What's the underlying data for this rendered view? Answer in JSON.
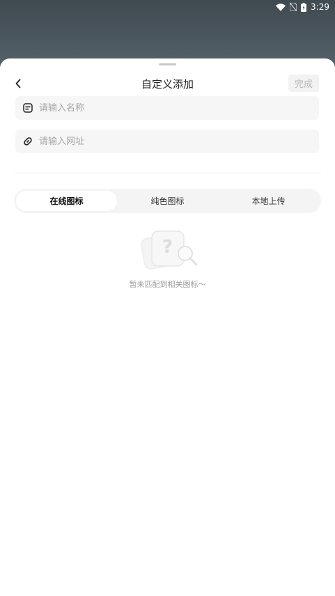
{
  "status_bar": {
    "time": "3:29",
    "icons": [
      "wifi-icon",
      "no-sim-icon",
      "battery-charging-icon"
    ]
  },
  "header": {
    "title": "自定义添加",
    "back_icon": "chevron-left-icon",
    "done_label": "完成"
  },
  "form": {
    "name_placeholder": "请输入名称",
    "name_icon": "label-icon",
    "url_placeholder": "请输入网址",
    "url_icon": "link-icon"
  },
  "tabs": [
    {
      "label": "在线图标",
      "active": true
    },
    {
      "label": "纯色图标",
      "active": false
    },
    {
      "label": "本地上传",
      "active": false
    }
  ],
  "empty_state": {
    "icon": "no-match-illustration-icon",
    "text": "暂未匹配到相关图标～"
  },
  "colors": {
    "backdrop": "#4a555c",
    "sheet": "#ffffff",
    "field_bg": "#f6f6f6",
    "placeholder": "#a6a6a6",
    "done_text": "#b5b5b5"
  }
}
